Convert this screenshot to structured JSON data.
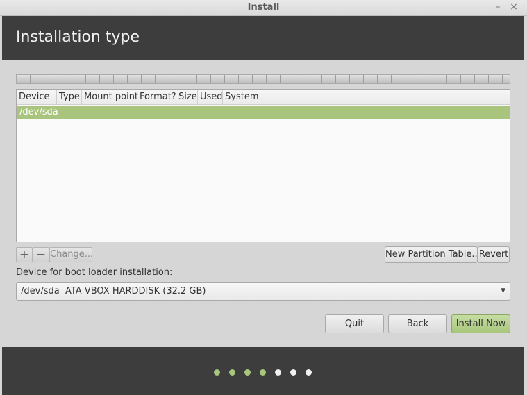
{
  "window": {
    "title": "Install",
    "minimize_glyph": "–",
    "close_glyph": "×"
  },
  "header": {
    "title": "Installation type"
  },
  "table": {
    "columns": [
      "Device",
      "Type",
      "Mount point",
      "Format?",
      "Size",
      "Used",
      "System"
    ],
    "rows": [
      {
        "device": "/dev/sda"
      }
    ]
  },
  "toolbar": {
    "add": "+",
    "remove": "−",
    "change": "Change...",
    "new_table": "New Partition Table...",
    "revert": "Revert"
  },
  "bootloader": {
    "label": "Device for boot loader installation:",
    "value": "/dev/sda  ATA VBOX HARDDISK (32.2 GB)"
  },
  "buttons": {
    "quit": "Quit",
    "back": "Back",
    "install": "Install Now"
  },
  "progress": {
    "completed_steps": 4,
    "total_steps": 7
  },
  "colors": {
    "accent": "#a8c47d",
    "header_bg": "#3d3d3d"
  }
}
